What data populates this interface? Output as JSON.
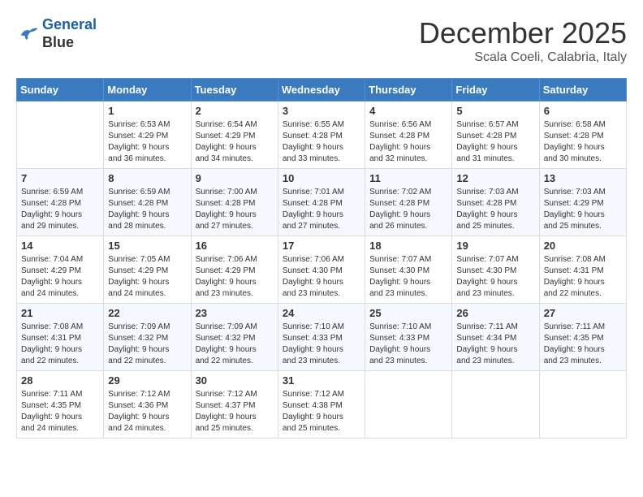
{
  "header": {
    "logo_line1": "General",
    "logo_line2": "Blue",
    "month": "December 2025",
    "location": "Scala Coeli, Calabria, Italy"
  },
  "days_of_week": [
    "Sunday",
    "Monday",
    "Tuesday",
    "Wednesday",
    "Thursday",
    "Friday",
    "Saturday"
  ],
  "weeks": [
    [
      {
        "day": "",
        "content": ""
      },
      {
        "day": "1",
        "content": "Sunrise: 6:53 AM\nSunset: 4:29 PM\nDaylight: 9 hours\nand 36 minutes."
      },
      {
        "day": "2",
        "content": "Sunrise: 6:54 AM\nSunset: 4:29 PM\nDaylight: 9 hours\nand 34 minutes."
      },
      {
        "day": "3",
        "content": "Sunrise: 6:55 AM\nSunset: 4:28 PM\nDaylight: 9 hours\nand 33 minutes."
      },
      {
        "day": "4",
        "content": "Sunrise: 6:56 AM\nSunset: 4:28 PM\nDaylight: 9 hours\nand 32 minutes."
      },
      {
        "day": "5",
        "content": "Sunrise: 6:57 AM\nSunset: 4:28 PM\nDaylight: 9 hours\nand 31 minutes."
      },
      {
        "day": "6",
        "content": "Sunrise: 6:58 AM\nSunset: 4:28 PM\nDaylight: 9 hours\nand 30 minutes."
      }
    ],
    [
      {
        "day": "7",
        "content": "Sunrise: 6:59 AM\nSunset: 4:28 PM\nDaylight: 9 hours\nand 29 minutes."
      },
      {
        "day": "8",
        "content": "Sunrise: 6:59 AM\nSunset: 4:28 PM\nDaylight: 9 hours\nand 28 minutes."
      },
      {
        "day": "9",
        "content": "Sunrise: 7:00 AM\nSunset: 4:28 PM\nDaylight: 9 hours\nand 27 minutes."
      },
      {
        "day": "10",
        "content": "Sunrise: 7:01 AM\nSunset: 4:28 PM\nDaylight: 9 hours\nand 27 minutes."
      },
      {
        "day": "11",
        "content": "Sunrise: 7:02 AM\nSunset: 4:28 PM\nDaylight: 9 hours\nand 26 minutes."
      },
      {
        "day": "12",
        "content": "Sunrise: 7:03 AM\nSunset: 4:28 PM\nDaylight: 9 hours\nand 25 minutes."
      },
      {
        "day": "13",
        "content": "Sunrise: 7:03 AM\nSunset: 4:29 PM\nDaylight: 9 hours\nand 25 minutes."
      }
    ],
    [
      {
        "day": "14",
        "content": "Sunrise: 7:04 AM\nSunset: 4:29 PM\nDaylight: 9 hours\nand 24 minutes."
      },
      {
        "day": "15",
        "content": "Sunrise: 7:05 AM\nSunset: 4:29 PM\nDaylight: 9 hours\nand 24 minutes."
      },
      {
        "day": "16",
        "content": "Sunrise: 7:06 AM\nSunset: 4:29 PM\nDaylight: 9 hours\nand 23 minutes."
      },
      {
        "day": "17",
        "content": "Sunrise: 7:06 AM\nSunset: 4:30 PM\nDaylight: 9 hours\nand 23 minutes."
      },
      {
        "day": "18",
        "content": "Sunrise: 7:07 AM\nSunset: 4:30 PM\nDaylight: 9 hours\nand 23 minutes."
      },
      {
        "day": "19",
        "content": "Sunrise: 7:07 AM\nSunset: 4:30 PM\nDaylight: 9 hours\nand 23 minutes."
      },
      {
        "day": "20",
        "content": "Sunrise: 7:08 AM\nSunset: 4:31 PM\nDaylight: 9 hours\nand 22 minutes."
      }
    ],
    [
      {
        "day": "21",
        "content": "Sunrise: 7:08 AM\nSunset: 4:31 PM\nDaylight: 9 hours\nand 22 minutes."
      },
      {
        "day": "22",
        "content": "Sunrise: 7:09 AM\nSunset: 4:32 PM\nDaylight: 9 hours\nand 22 minutes."
      },
      {
        "day": "23",
        "content": "Sunrise: 7:09 AM\nSunset: 4:32 PM\nDaylight: 9 hours\nand 22 minutes."
      },
      {
        "day": "24",
        "content": "Sunrise: 7:10 AM\nSunset: 4:33 PM\nDaylight: 9 hours\nand 23 minutes."
      },
      {
        "day": "25",
        "content": "Sunrise: 7:10 AM\nSunset: 4:33 PM\nDaylight: 9 hours\nand 23 minutes."
      },
      {
        "day": "26",
        "content": "Sunrise: 7:11 AM\nSunset: 4:34 PM\nDaylight: 9 hours\nand 23 minutes."
      },
      {
        "day": "27",
        "content": "Sunrise: 7:11 AM\nSunset: 4:35 PM\nDaylight: 9 hours\nand 23 minutes."
      }
    ],
    [
      {
        "day": "28",
        "content": "Sunrise: 7:11 AM\nSunset: 4:35 PM\nDaylight: 9 hours\nand 24 minutes."
      },
      {
        "day": "29",
        "content": "Sunrise: 7:12 AM\nSunset: 4:36 PM\nDaylight: 9 hours\nand 24 minutes."
      },
      {
        "day": "30",
        "content": "Sunrise: 7:12 AM\nSunset: 4:37 PM\nDaylight: 9 hours\nand 25 minutes."
      },
      {
        "day": "31",
        "content": "Sunrise: 7:12 AM\nSunset: 4:38 PM\nDaylight: 9 hours\nand 25 minutes."
      },
      {
        "day": "",
        "content": ""
      },
      {
        "day": "",
        "content": ""
      },
      {
        "day": "",
        "content": ""
      }
    ]
  ]
}
